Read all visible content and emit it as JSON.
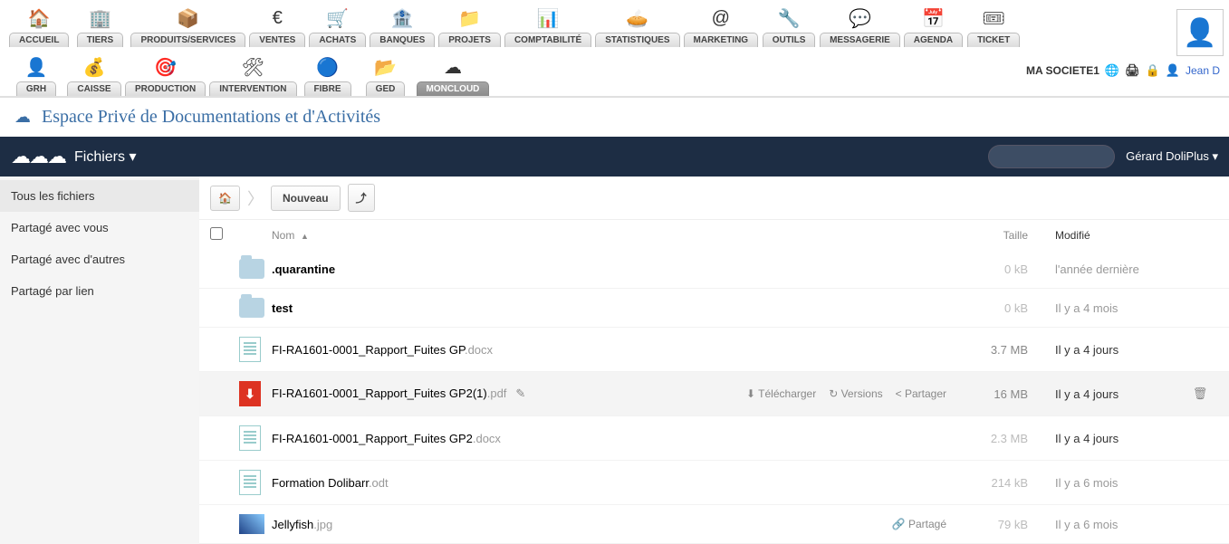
{
  "top_tabs_row1": [
    {
      "label": "ACCUEIL",
      "icon": "🏠"
    },
    {
      "label": "TIERS",
      "icon": "🏢"
    },
    {
      "label": "PRODUITS/SERVICES",
      "icon": "📦"
    },
    {
      "label": "VENTES",
      "icon": "€"
    },
    {
      "label": "ACHATS",
      "icon": "🛒"
    },
    {
      "label": "BANQUES",
      "icon": "🏦"
    },
    {
      "label": "PROJETS",
      "icon": "📁"
    },
    {
      "label": "COMPTABILITÉ",
      "icon": "📊"
    },
    {
      "label": "STATISTIQUES",
      "icon": "🥧"
    },
    {
      "label": "MARKETING",
      "icon": "@"
    },
    {
      "label": "OUTILS",
      "icon": "🔧"
    },
    {
      "label": "MESSAGERIE",
      "icon": "💬"
    },
    {
      "label": "AGENDA",
      "icon": "📅"
    },
    {
      "label": "TICKET",
      "icon": "🎟"
    }
  ],
  "top_tabs_row2": [
    {
      "label": "GRH",
      "icon": "👤"
    },
    {
      "label": "CAISSE",
      "icon": "💰"
    },
    {
      "label": "PRODUCTION",
      "icon": "🎯"
    },
    {
      "label": "INTERVENTION",
      "icon": "🛠"
    },
    {
      "label": "FIBRE",
      "icon": "🔵"
    },
    {
      "label": "GED",
      "icon": "📂"
    },
    {
      "label": "MONCLOUD",
      "icon": "☁",
      "active": true
    }
  ],
  "company": "MA SOCIETE1",
  "user_top": "Jean D",
  "page_title": "Espace Privé de Documentations et d'Activités",
  "oc": {
    "app_label": "Fichiers ▾",
    "user": "Gérard DoliPlus ▾",
    "side": [
      {
        "label": "Tous les fichiers",
        "active": true
      },
      {
        "label": "Partagé avec vous"
      },
      {
        "label": "Partagé avec d'autres"
      },
      {
        "label": "Partagé par lien"
      }
    ],
    "new_btn": "Nouveau",
    "headers": {
      "name": "Nom",
      "sort": "▲",
      "size": "Taille",
      "modified": "Modifié"
    },
    "actions": {
      "download": "Télécharger",
      "versions": "Versions",
      "share": "Partager",
      "shared": "Partagé"
    },
    "rows": [
      {
        "type": "folder",
        "name": ".quarantine",
        "ext": "",
        "size": "0 kB",
        "mod": "l'année dernière",
        "bold": true,
        "dimsize": true,
        "dimmod": true
      },
      {
        "type": "folder",
        "name": "test",
        "ext": "",
        "size": "0 kB",
        "mod": "Il y a 4 mois",
        "bold": true,
        "dimsize": true,
        "dimmod": true
      },
      {
        "type": "doc",
        "name": "FI-RA1601-0001_Rapport_Fuites GP",
        "ext": ".docx",
        "size": "3.7 MB",
        "mod": "Il y a 4 jours"
      },
      {
        "type": "pdf",
        "name": "FI-RA1601-0001_Rapport_Fuites GP2(1)",
        "ext": ".pdf",
        "size": "16 MB",
        "mod": "Il y a 4 jours",
        "hover": true,
        "showactions": true
      },
      {
        "type": "doc",
        "name": "FI-RA1601-0001_Rapport_Fuites GP2",
        "ext": ".docx",
        "size": "2.3 MB",
        "mod": "Il y a 4 jours",
        "dimsize": true
      },
      {
        "type": "doc",
        "name": "Formation Dolibarr",
        "ext": ".odt",
        "size": "214 kB",
        "mod": "Il y a 6 mois",
        "dimsize": true,
        "dimmod": true
      },
      {
        "type": "img",
        "name": "Jellyfish",
        "ext": ".jpg",
        "size": "79 kB",
        "mod": "Il y a 6 mois",
        "shared": true,
        "dimsize": true,
        "dimmod": true
      }
    ]
  }
}
